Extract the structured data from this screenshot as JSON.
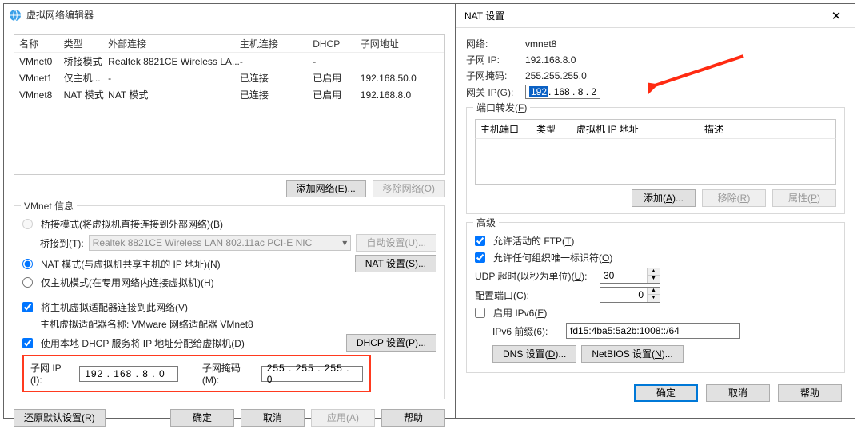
{
  "main": {
    "title": "虚拟网络编辑器",
    "columns": {
      "name": "名称",
      "type": "类型",
      "ext": "外部连接",
      "host": "主机连接",
      "dhcp": "DHCP",
      "subnet": "子网地址"
    },
    "rows": [
      {
        "name": "VMnet0",
        "type": "桥接模式",
        "ext": "Realtek 8821CE Wireless LA...",
        "host": "-",
        "dhcp": "-",
        "subnet": ""
      },
      {
        "name": "VMnet1",
        "type": "仅主机...",
        "ext": "-",
        "host": "已连接",
        "dhcp": "已启用",
        "subnet": "192.168.50.0"
      },
      {
        "name": "VMnet8",
        "type": "NAT 模式",
        "ext": "NAT 模式",
        "host": "已连接",
        "dhcp": "已启用",
        "subnet": "192.168.8.0"
      }
    ],
    "btn_add": "添加网络(E)...",
    "btn_remove": "移除网络(O)",
    "group_title": "VMnet 信息",
    "rb_bridge": "桥接模式(将虚拟机直接连接到外部网络)(B)",
    "lbl_bridge_to": "桥接到(T):",
    "sel_bridge": "Realtek 8821CE Wireless LAN 802.11ac PCI-E NIC",
    "btn_auto": "自动设置(U)...",
    "rb_nat": "NAT 模式(与虚拟机共享主机的 IP 地址)(N)",
    "btn_nat": "NAT 设置(S)...",
    "rb_host": "仅主机模式(在专用网络内连接虚拟机)(H)",
    "cb_hostadapter": "将主机虚拟适配器连接到此网络(V)",
    "lbl_hostadapter": "主机虚拟适配器名称: VMware 网络适配器 VMnet8",
    "cb_dhcp": "使用本地 DHCP 服务将 IP 地址分配给虚拟机(D)",
    "btn_dhcp": "DHCP 设置(P)...",
    "lbl_subip": "子网 IP (I):",
    "val_subip": "192 . 168 .  8  .  0",
    "lbl_mask": "子网掩码(M):",
    "val_mask": "255 . 255 . 255 .  0",
    "btn_restore": "还原默认设置(R)",
    "btn_ok": "确定",
    "btn_cancel": "取消",
    "btn_apply": "应用(A)",
    "btn_help": "帮助"
  },
  "nat": {
    "title": "NAT 设置",
    "lbl_net": "网络:",
    "val_net": "vmnet8",
    "lbl_subip": "子网 IP:",
    "val_subip": "192.168.8.0",
    "lbl_mask": "子网掩码:",
    "val_mask": "255.255.255.0",
    "lbl_gw": "网关 IP(G):",
    "gw_sel": "192",
    "gw_rest": " . 168 .  8  .  2",
    "pf_title": "端口转发(F)",
    "pf_cols": {
      "a": "主机端口",
      "b": "类型",
      "c": "虚拟机 IP 地址",
      "d": "描述"
    },
    "btn_add": "添加(A)...",
    "btn_remove": "移除(R)",
    "btn_prop": "属性(P)",
    "adv_title": "高级",
    "cb_ftp": "允许活动的 FTP(T)",
    "cb_unique": "允许任何组织唯一标识符(O)",
    "lbl_udp": "UDP 超时(以秒为单位)(U):",
    "val_udp": "30",
    "lbl_cfgport": "配置端口(C):",
    "val_cfgport": "0",
    "cb_ipv6": "启用 IPv6(E)",
    "lbl_prefix": "IPv6 前缀(6):",
    "val_prefix": "fd15:4ba5:5a2b:1008::/64",
    "btn_dns": "DNS 设置(D)...",
    "btn_netbios": "NetBIOS 设置(N)...",
    "btn_ok": "确定",
    "btn_cancel": "取消",
    "btn_help": "帮助"
  }
}
